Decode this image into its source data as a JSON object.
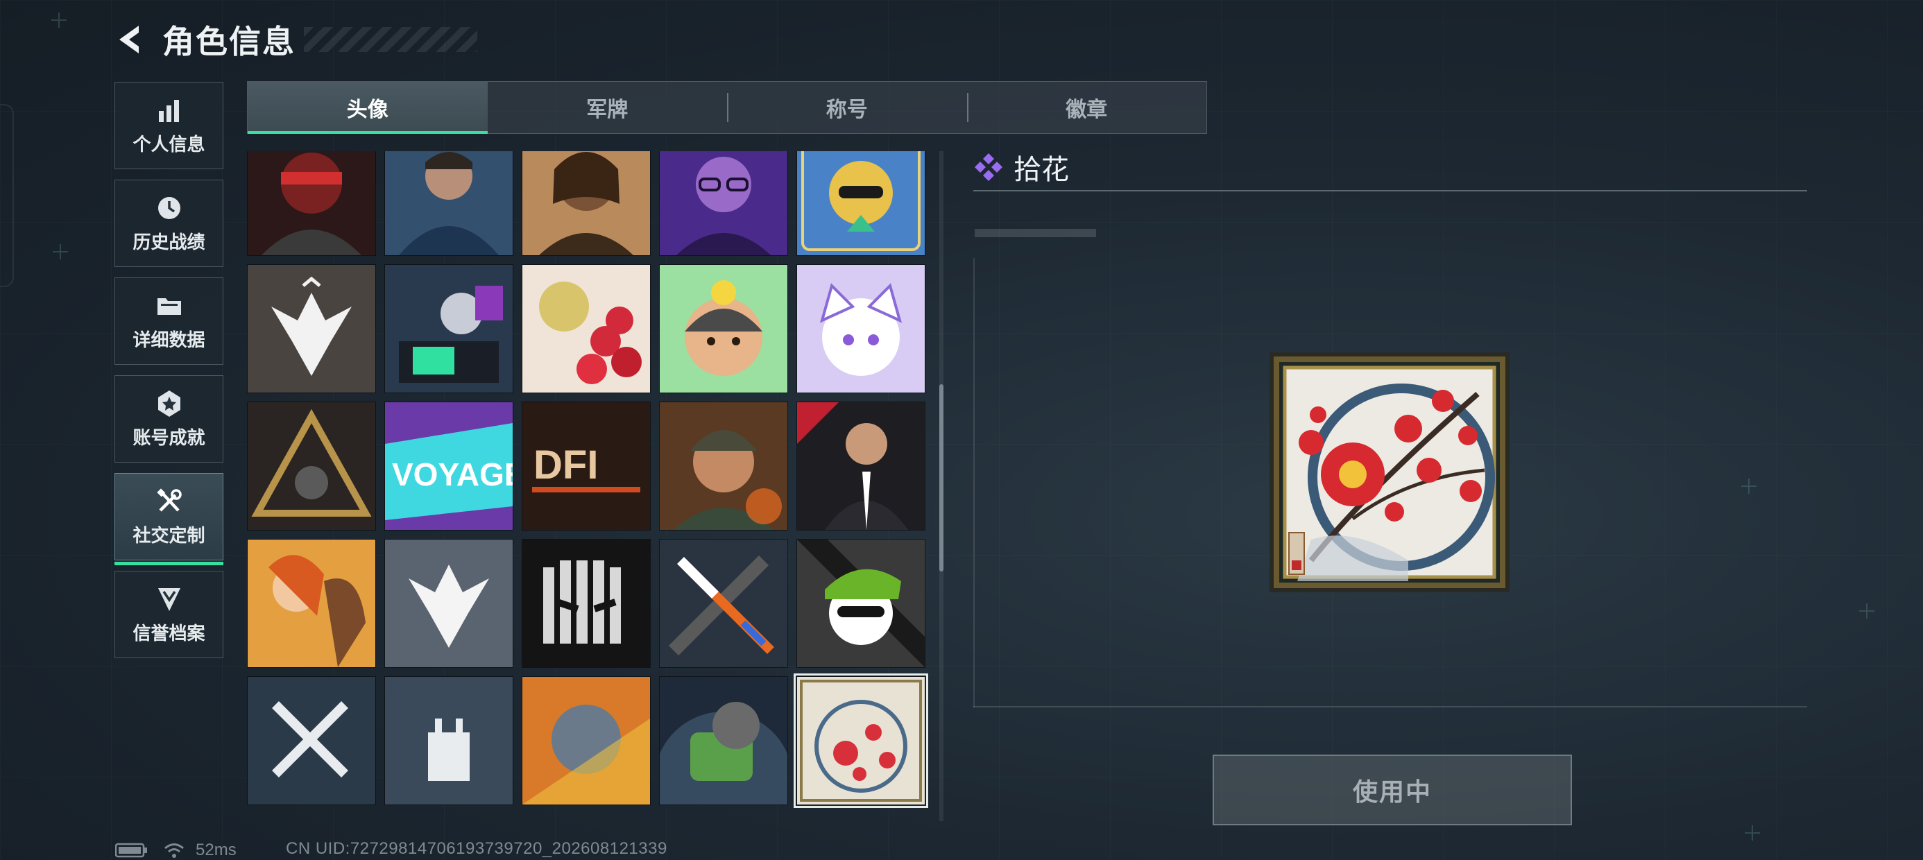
{
  "header": {
    "title": "角色信息"
  },
  "sidebar": {
    "items": [
      {
        "label": "个人信息",
        "icon": "bar-chart-icon"
      },
      {
        "label": "历史战绩",
        "icon": "history-clock-icon"
      },
      {
        "label": "详细数据",
        "icon": "folder-icon"
      },
      {
        "label": "账号成就",
        "icon": "achievement-star-icon"
      },
      {
        "label": "社交定制",
        "icon": "tools-icon",
        "active": true
      },
      {
        "label": "信誉档案",
        "icon": "shield-chevron-icon"
      }
    ]
  },
  "tabs": [
    {
      "label": "头像",
      "active": true
    },
    {
      "label": "军牌"
    },
    {
      "label": "称号"
    },
    {
      "label": "徽章"
    }
  ],
  "detail": {
    "title": "拾花",
    "use_button_label": "使用中"
  },
  "status": {
    "latency": "52ms",
    "uid": "CN UID:7272981470619373972​0_202608121339"
  },
  "colors": {
    "accent": "#38e0a0",
    "purple": "#9a6cf0"
  }
}
